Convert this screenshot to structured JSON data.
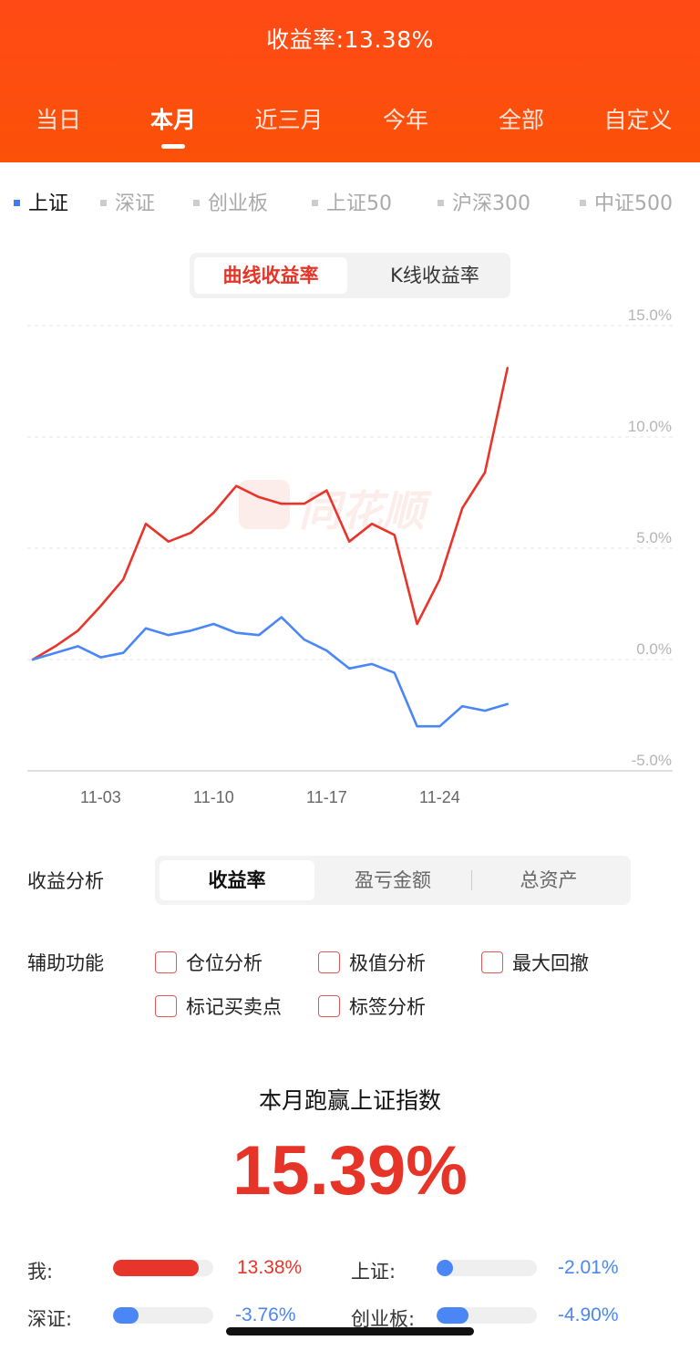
{
  "header": {
    "title": "收益率:13.38%",
    "tabs": [
      "当日",
      "本月",
      "近三月",
      "今年",
      "全部",
      "自定义"
    ],
    "active_tab": "本月"
  },
  "index_tabs": {
    "items": [
      "上证",
      "深证",
      "创业板",
      "上证50",
      "沪深300",
      "中证500"
    ],
    "active": "上证",
    "active_color": "#3d7cf2"
  },
  "chart_toggle": {
    "options": [
      "曲线收益率",
      "K线收益率"
    ],
    "active": "曲线收益率"
  },
  "watermark": "同花顺",
  "chart_data": {
    "type": "line",
    "ytick_labels": [
      "15.0%",
      "10.0%",
      "5.0%",
      "0.0%",
      "-5.0%"
    ],
    "ylim": [
      -5,
      15
    ],
    "xtick_labels": [
      "11-03",
      "11-10",
      "11-17",
      "11-24"
    ],
    "x": [
      "10-31",
      "11-01",
      "11-02",
      "11-03",
      "11-04",
      "11-05",
      "11-06",
      "11-07",
      "11-10",
      "11-11",
      "11-12",
      "11-13",
      "11-14",
      "11-17",
      "11-18",
      "11-19",
      "11-20",
      "11-21",
      "11-24",
      "11-25",
      "11-26",
      "11-27",
      "11-28"
    ],
    "series": [
      {
        "color": "#e8352b",
        "values": [
          0,
          0.6,
          1.3,
          2.4,
          3.6,
          6.1,
          5.3,
          5.7,
          6.6,
          7.8,
          7.3,
          7.0,
          7.0,
          7.6,
          5.3,
          6.1,
          5.6,
          1.6,
          3.6,
          6.8,
          8.4,
          13.1,
          null
        ]
      },
      {
        "color": "#4a86f5",
        "values": [
          0,
          0.3,
          0.6,
          0.1,
          0.3,
          1.4,
          1.1,
          1.3,
          1.6,
          1.2,
          1.1,
          1.9,
          0.9,
          0.4,
          -0.4,
          -0.2,
          -0.6,
          -3.0,
          -3.0,
          -2.1,
          -2.3,
          -2.0,
          null
        ]
      }
    ]
  },
  "analysis": {
    "label": "收益分析",
    "options": [
      "收益率",
      "盈亏金额",
      "总资产"
    ],
    "active": "收益率"
  },
  "aux": {
    "label": "辅助功能",
    "items": [
      "仓位分析",
      "极值分析",
      "最大回撤",
      "标记买卖点",
      "标签分析"
    ]
  },
  "beat": {
    "title": "本月跑赢上证指数",
    "value": "15.39%"
  },
  "comparison": [
    {
      "label": "我:",
      "value": "13.38%",
      "fill": 0.85,
      "color": "#e8352b"
    },
    {
      "label": "上证:",
      "value": "-2.01%",
      "fill": 0.13,
      "color": "#4a86f5"
    },
    {
      "label": "深证:",
      "value": "-3.76%",
      "fill": 0.25,
      "color": "#4a86f5"
    },
    {
      "label": "创业板:",
      "value": "-4.90%",
      "fill": 0.32,
      "color": "#4a86f5"
    }
  ]
}
